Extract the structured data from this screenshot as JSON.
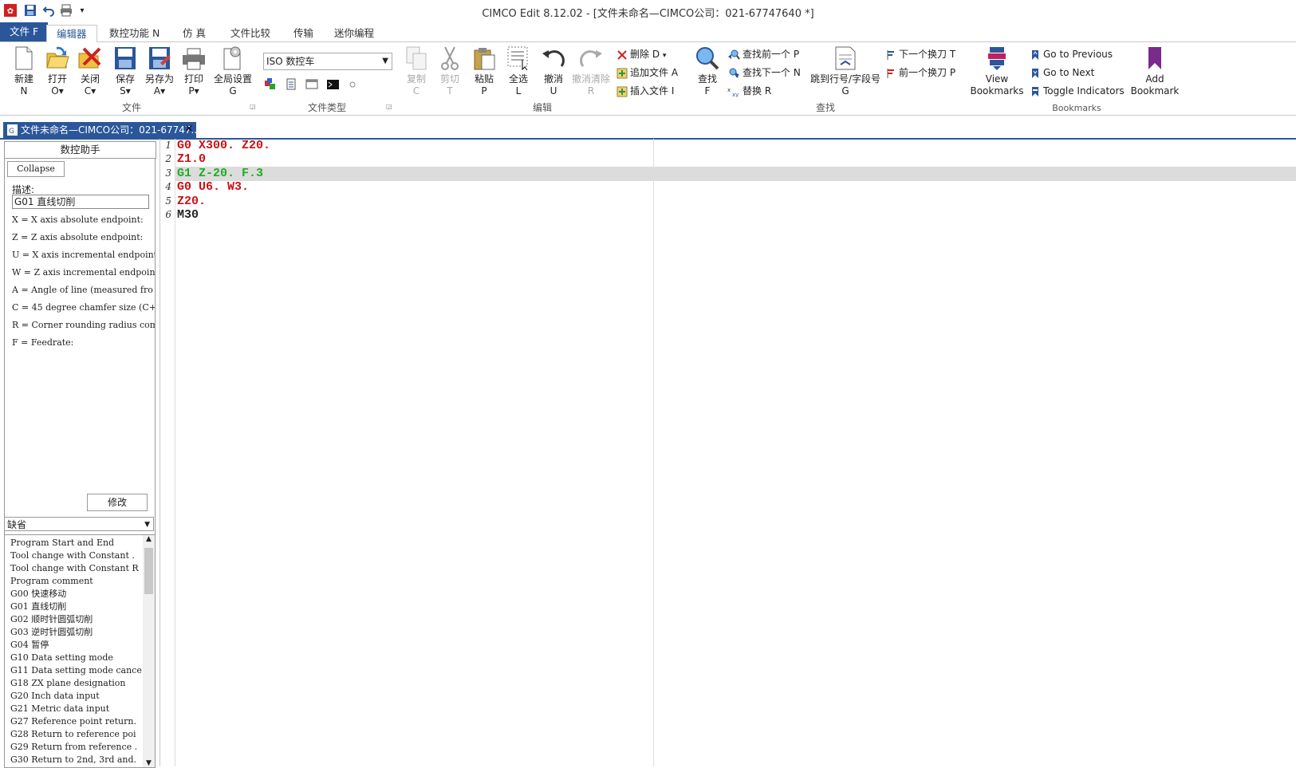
{
  "window": {
    "title": "CIMCO Edit 8.12.02 - [文件未命名—CIMCO公司：021-67747640 *]"
  },
  "tabs": [
    {
      "label": "文件 F"
    },
    {
      "label": "编辑器"
    },
    {
      "label": "数控功能 N"
    },
    {
      "label": "仿 真"
    },
    {
      "label": "文件比较"
    },
    {
      "label": "传输"
    },
    {
      "label": "迷你编程"
    }
  ],
  "ribbon": {
    "file_group": {
      "label": "文件",
      "buttons": [
        {
          "label": "新建",
          "key": "N"
        },
        {
          "label": "打开",
          "key": "O▾"
        },
        {
          "label": "关闭",
          "key": "C▾"
        },
        {
          "label": "保存",
          "key": "S▾"
        },
        {
          "label": "另存为",
          "key": "A▾"
        },
        {
          "label": "打印",
          "key": "P▾"
        },
        {
          "label": "全局设置",
          "key": "G"
        }
      ]
    },
    "filetype_group": {
      "label": "文件类型",
      "selected": "ISO 数控车"
    },
    "edit_group": {
      "label": "编辑",
      "buttons": [
        {
          "label": "复制",
          "key": "C"
        },
        {
          "label": "剪切",
          "key": "T"
        },
        {
          "label": "粘贴",
          "key": "P"
        },
        {
          "label": "全选",
          "key": "L"
        },
        {
          "label": "撤消",
          "key": "U"
        },
        {
          "label": "撤消清除",
          "key": "R"
        }
      ],
      "small": [
        {
          "label": "删除 D",
          "caret": "▾"
        },
        {
          "label": "追加文件 A"
        },
        {
          "label": "插入文件 I"
        }
      ]
    },
    "find_group": {
      "label": "查找",
      "find": {
        "label": "查找",
        "key": "F"
      },
      "small": [
        {
          "label": "查找前一个 P"
        },
        {
          "label": "查找下一个 N"
        },
        {
          "label": "替换 R"
        }
      ],
      "goto": {
        "label": "跳到行号/字段号",
        "key": "G"
      },
      "tool": [
        {
          "label": "下一个换刀 T"
        },
        {
          "label": "前一个换刀 P"
        }
      ]
    },
    "bookmarks_group": {
      "label": "Bookmarks",
      "view": {
        "line1": "View",
        "line2": "Bookmarks"
      },
      "items": [
        {
          "label": "Go to Previous"
        },
        {
          "label": "Go to Next"
        },
        {
          "label": "Toggle Indicators"
        }
      ],
      "add": {
        "line1": "Add",
        "line2": "Bookmark"
      }
    }
  },
  "doc_tab": {
    "label": "文件未命名—CIMCO公司：021-67747..."
  },
  "assistant": {
    "header": "数控助手",
    "collapse": "Collapse",
    "desc_label": "描述:",
    "desc_value": "G01 直线切削",
    "params": [
      "X = X axis absolute endpoint:",
      "Z = Z axis absolute endpoint:",
      "U = X axis incremental endpoint",
      "W = Z axis incremental endpoint",
      "A = Angle of line (measured fro",
      "C = 45 degree chamfer size (C+",
      "R = Corner rounding radius comm",
      "F = Feedrate:"
    ],
    "modify": "修改",
    "category": "缺省",
    "list": [
      "Program Start and End",
      "Tool change with Constant .",
      "Tool change with Constant R",
      "Program comment",
      "G00 快速移动",
      "G01 直线切削",
      "G02 顺时针圆弧切削",
      "G03 逆时针圆弧切削",
      "G04 暂停",
      "G10 Data setting mode",
      "G11 Data setting mode cance",
      "G18 ZX plane designation",
      "G20 Inch data input",
      "G21 Metric data input",
      "G27 Reference point return.",
      "G28 Return to reference poi",
      "G29 Return from reference .",
      "G30 Return to 2nd, 3rd and."
    ]
  },
  "editor": {
    "lines": [
      {
        "n": "1",
        "text": "G0 X300. Z20.",
        "color": "#cc1111"
      },
      {
        "n": "2",
        "text": "Z1.0",
        "color": "#cc1111"
      },
      {
        "n": "3",
        "text": "G1 Z-20. F.3",
        "color": "#22aa22"
      },
      {
        "n": "4",
        "text": "G0 U6. W3.",
        "color": "#cc1111"
      },
      {
        "n": "5",
        "text": "Z20.",
        "color": "#cc1111"
      },
      {
        "n": "6",
        "text": "M30",
        "color": "#222222"
      }
    ]
  }
}
